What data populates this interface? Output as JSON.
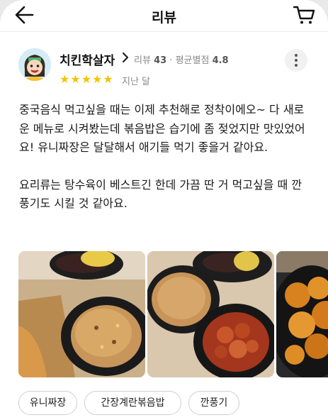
{
  "header": {
    "title": "리뷰"
  },
  "review": {
    "nickname": "치킨학살자",
    "review_count_label": "리뷰",
    "review_count": "43",
    "separator": "·",
    "avg_rating_label": "평균별점",
    "avg_rating": "4.8",
    "stars": "★★★★★",
    "rating": 5,
    "time": "지난 달",
    "paragraph1": "중국음식 먹고싶을 때는 이제 추천해로 정착이에오~ 다 새로운 메뉴로 시켜봤는데 볶음밥은 습기에 좀 젖었지만 맛있었어요! 유니짜장은 달달해서 애기들 먹기 좋을거 같아요.",
    "paragraph2": "요리류는 탕수육이 베스트긴 한데 가끔 딴 거 먹고싶을 때 깐풍기도 시킬 것 같아요."
  },
  "tags": [
    "유니짜장",
    "간장계란볶음밥",
    "깐풍기"
  ],
  "icons": {
    "back": "back-arrow-icon",
    "cart": "cart-icon",
    "chevron": "chevron-right-icon",
    "more": "more-vertical-icon",
    "star": "star-icon"
  },
  "colors": {
    "star": "#f5c400",
    "muted": "#8a8a8a",
    "border": "#cfcfcf"
  }
}
